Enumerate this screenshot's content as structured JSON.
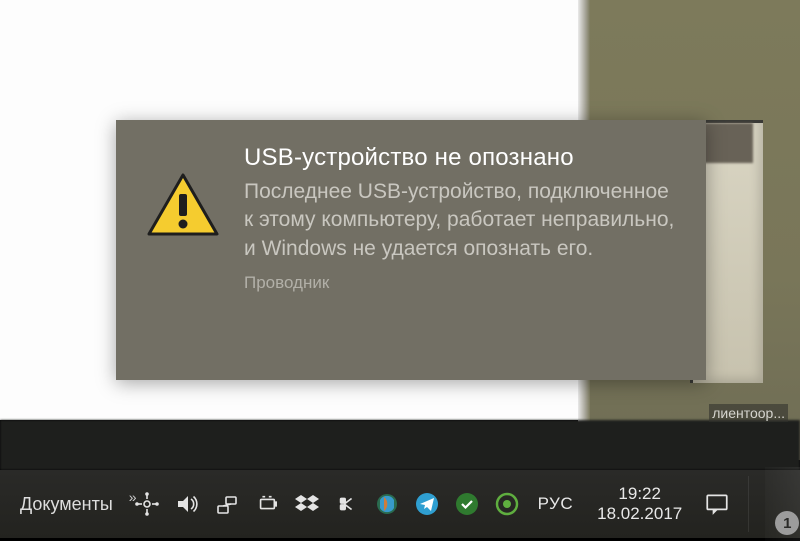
{
  "notification": {
    "title": "USB-устройство не опознано",
    "body": "Последнее USB-устройство, подключенное к этому компьютеру, работает неправильно, и Windows не удается опознать его.",
    "source": "Проводник",
    "icon": "warning-triangle"
  },
  "taskbar": {
    "pinned_label": "Документы",
    "overflow_glyph": "»",
    "language": "РУС",
    "time": "19:22",
    "date": "18.02.2017",
    "notification_badge": "1"
  },
  "background": {
    "partial_text": "лиентоор..."
  },
  "tray_icons": [
    "sync-icon",
    "volume-icon",
    "network-icon",
    "power-icon",
    "dropbox-icon",
    "bluetooth-icon",
    "browser-icon",
    "telegram-icon",
    "antivirus-icon",
    "record-icon"
  ]
}
